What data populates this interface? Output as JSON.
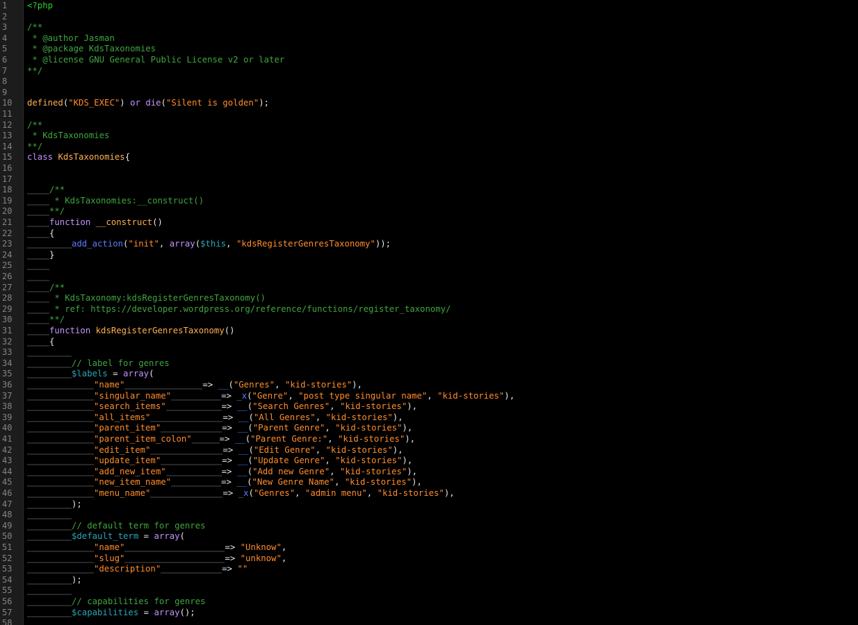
{
  "editor": {
    "lines": [
      {
        "n": "1",
        "indent": 0,
        "tokens": [
          {
            "t": "<?php",
            "c": "tag"
          }
        ]
      },
      {
        "n": "2",
        "indent": 0,
        "tokens": []
      },
      {
        "n": "3",
        "indent": 0,
        "tokens": [
          {
            "t": "/**",
            "c": "comment"
          }
        ]
      },
      {
        "n": "4",
        "indent": 0,
        "tokens": [
          {
            "t": " * @author Jasman",
            "c": "comment"
          }
        ]
      },
      {
        "n": "5",
        "indent": 0,
        "tokens": [
          {
            "t": " * @package KdsTaxonomies",
            "c": "comment"
          }
        ]
      },
      {
        "n": "6",
        "indent": 0,
        "tokens": [
          {
            "t": " * @license GNU General Public License v2 or later",
            "c": "comment"
          }
        ]
      },
      {
        "n": "7",
        "indent": 0,
        "tokens": [
          {
            "t": "**/",
            "c": "comment"
          }
        ]
      },
      {
        "n": "8",
        "indent": 0,
        "tokens": []
      },
      {
        "n": "9",
        "indent": 0,
        "tokens": []
      },
      {
        "n": "10",
        "indent": 0,
        "tokens": [
          {
            "t": "defined",
            "c": "func"
          },
          {
            "t": "(",
            "c": "plain"
          },
          {
            "t": "\"KDS_EXEC\"",
            "c": "string"
          },
          {
            "t": ") ",
            "c": "plain"
          },
          {
            "t": "or",
            "c": "keyword"
          },
          {
            "t": " ",
            "c": "plain"
          },
          {
            "t": "die",
            "c": "keyword"
          },
          {
            "t": "(",
            "c": "plain"
          },
          {
            "t": "\"Silent is golden\"",
            "c": "string"
          },
          {
            "t": ");",
            "c": "plain"
          }
        ]
      },
      {
        "n": "11",
        "indent": 0,
        "tokens": []
      },
      {
        "n": "12",
        "indent": 0,
        "tokens": [
          {
            "t": "/**",
            "c": "comment"
          }
        ]
      },
      {
        "n": "13",
        "indent": 0,
        "tokens": [
          {
            "t": " * KdsTaxonomies",
            "c": "comment"
          }
        ]
      },
      {
        "n": "14",
        "indent": 0,
        "tokens": [
          {
            "t": "**/",
            "c": "comment"
          }
        ]
      },
      {
        "n": "15",
        "indent": 0,
        "tokens": [
          {
            "t": "class",
            "c": "keyword"
          },
          {
            "t": " ",
            "c": "plain"
          },
          {
            "t": "KdsTaxonomies",
            "c": "func"
          },
          {
            "t": "{",
            "c": "plain"
          }
        ]
      },
      {
        "n": "16",
        "indent": 0,
        "tokens": []
      },
      {
        "n": "17",
        "indent": 0,
        "tokens": []
      },
      {
        "n": "18",
        "indent": 1,
        "tokens": [
          {
            "t": "/**",
            "c": "comment"
          }
        ]
      },
      {
        "n": "19",
        "indent": 1,
        "tokens": [
          {
            "t": " * KdsTaxonomies:__construct()",
            "c": "comment"
          }
        ]
      },
      {
        "n": "20",
        "indent": 1,
        "tokens": [
          {
            "t": "**/",
            "c": "comment"
          }
        ]
      },
      {
        "n": "21",
        "indent": 1,
        "tokens": [
          {
            "t": "function",
            "c": "keyword"
          },
          {
            "t": " ",
            "c": "plain"
          },
          {
            "t": "__construct",
            "c": "func"
          },
          {
            "t": "()",
            "c": "plain"
          }
        ]
      },
      {
        "n": "22",
        "indent": 1,
        "tokens": [
          {
            "t": "{",
            "c": "plain"
          }
        ]
      },
      {
        "n": "23",
        "indent": 2,
        "tokens": [
          {
            "t": "add_action",
            "c": "builtin"
          },
          {
            "t": "(",
            "c": "plain"
          },
          {
            "t": "\"init\"",
            "c": "string"
          },
          {
            "t": ", ",
            "c": "plain"
          },
          {
            "t": "array",
            "c": "keyword"
          },
          {
            "t": "(",
            "c": "plain"
          },
          {
            "t": "$this",
            "c": "var"
          },
          {
            "t": ", ",
            "c": "plain"
          },
          {
            "t": "\"kdsRegisterGenresTaxonomy\"",
            "c": "string"
          },
          {
            "t": "));",
            "c": "plain"
          }
        ]
      },
      {
        "n": "24",
        "indent": 1,
        "tokens": [
          {
            "t": "}",
            "c": "plain"
          }
        ]
      },
      {
        "n": "25",
        "indent": 1,
        "tokens": []
      },
      {
        "n": "26",
        "indent": 1,
        "tokens": []
      },
      {
        "n": "27",
        "indent": 1,
        "tokens": [
          {
            "t": "/**",
            "c": "comment"
          }
        ]
      },
      {
        "n": "28",
        "indent": 1,
        "tokens": [
          {
            "t": " * KdsTaxonomy:kdsRegisterGenresTaxonomy()",
            "c": "comment"
          }
        ]
      },
      {
        "n": "29",
        "indent": 1,
        "tokens": [
          {
            "t": " * ref: https://developer.wordpress.org/reference/functions/register_taxonomy/",
            "c": "comment"
          }
        ]
      },
      {
        "n": "30",
        "indent": 1,
        "tokens": [
          {
            "t": "**/",
            "c": "comment"
          }
        ]
      },
      {
        "n": "31",
        "indent": 1,
        "tokens": [
          {
            "t": "function",
            "c": "keyword"
          },
          {
            "t": " ",
            "c": "plain"
          },
          {
            "t": "kdsRegisterGenresTaxonomy",
            "c": "func"
          },
          {
            "t": "()",
            "c": "plain"
          }
        ]
      },
      {
        "n": "32",
        "indent": 1,
        "tokens": [
          {
            "t": "{",
            "c": "plain"
          }
        ]
      },
      {
        "n": "33",
        "indent": 2,
        "tokens": []
      },
      {
        "n": "34",
        "indent": 2,
        "tokens": [
          {
            "t": "// label for genres",
            "c": "comment"
          }
        ]
      },
      {
        "n": "35",
        "indent": 2,
        "tokens": [
          {
            "t": "$labels",
            "c": "var"
          },
          {
            "t": " = ",
            "c": "plain"
          },
          {
            "t": "array",
            "c": "keyword"
          },
          {
            "t": "(",
            "c": "plain"
          }
        ]
      },
      {
        "n": "36",
        "indent": 3,
        "tokens": [
          {
            "t": "\"name\"",
            "c": "string"
          },
          {
            "pad": 14
          },
          {
            "t": "=> ",
            "c": "plain"
          },
          {
            "t": "__",
            "c": "builtin"
          },
          {
            "t": "(",
            "c": "plain"
          },
          {
            "t": "\"Genres\"",
            "c": "string"
          },
          {
            "t": ", ",
            "c": "plain"
          },
          {
            "t": "\"kid-stories\"",
            "c": "string"
          },
          {
            "t": "),",
            "c": "plain"
          }
        ]
      },
      {
        "n": "37",
        "indent": 3,
        "tokens": [
          {
            "t": "\"singular_name\"",
            "c": "string"
          },
          {
            "pad": 9
          },
          {
            "t": "=> ",
            "c": "plain"
          },
          {
            "t": "_x",
            "c": "builtin"
          },
          {
            "t": "(",
            "c": "plain"
          },
          {
            "t": "\"Genre\"",
            "c": "string"
          },
          {
            "t": ", ",
            "c": "plain"
          },
          {
            "t": "\"post type singular name\"",
            "c": "string"
          },
          {
            "t": ", ",
            "c": "plain"
          },
          {
            "t": "\"kid-stories\"",
            "c": "string"
          },
          {
            "t": "),",
            "c": "plain"
          }
        ]
      },
      {
        "n": "38",
        "indent": 3,
        "tokens": [
          {
            "t": "\"search_items\"",
            "c": "string"
          },
          {
            "pad": 10
          },
          {
            "t": "=> ",
            "c": "plain"
          },
          {
            "t": "__",
            "c": "builtin"
          },
          {
            "t": "(",
            "c": "plain"
          },
          {
            "t": "\"Search Genres\"",
            "c": "string"
          },
          {
            "t": ", ",
            "c": "plain"
          },
          {
            "t": "\"kid-stories\"",
            "c": "string"
          },
          {
            "t": "),",
            "c": "plain"
          }
        ]
      },
      {
        "n": "39",
        "indent": 3,
        "tokens": [
          {
            "t": "\"all_items\"",
            "c": "string"
          },
          {
            "pad": 13
          },
          {
            "t": "=> ",
            "c": "plain"
          },
          {
            "t": "__",
            "c": "builtin"
          },
          {
            "t": "(",
            "c": "plain"
          },
          {
            "t": "\"All Genres\"",
            "c": "string"
          },
          {
            "t": ", ",
            "c": "plain"
          },
          {
            "t": "\"kid-stories\"",
            "c": "string"
          },
          {
            "t": "),",
            "c": "plain"
          }
        ]
      },
      {
        "n": "40",
        "indent": 3,
        "tokens": [
          {
            "t": "\"parent_item\"",
            "c": "string"
          },
          {
            "pad": 11
          },
          {
            "t": "=> ",
            "c": "plain"
          },
          {
            "t": "__",
            "c": "builtin"
          },
          {
            "t": "(",
            "c": "plain"
          },
          {
            "t": "\"Parent Genre\"",
            "c": "string"
          },
          {
            "t": ", ",
            "c": "plain"
          },
          {
            "t": "\"kid-stories\"",
            "c": "string"
          },
          {
            "t": "),",
            "c": "plain"
          }
        ]
      },
      {
        "n": "41",
        "indent": 3,
        "tokens": [
          {
            "t": "\"parent_item_colon\"",
            "c": "string"
          },
          {
            "pad": 5
          },
          {
            "t": "=> ",
            "c": "plain"
          },
          {
            "t": "__",
            "c": "builtin"
          },
          {
            "t": "(",
            "c": "plain"
          },
          {
            "t": "\"Parent Genre:\"",
            "c": "string"
          },
          {
            "t": ", ",
            "c": "plain"
          },
          {
            "t": "\"kid-stories\"",
            "c": "string"
          },
          {
            "t": "),",
            "c": "plain"
          }
        ]
      },
      {
        "n": "42",
        "indent": 3,
        "tokens": [
          {
            "t": "\"edit_item\"",
            "c": "string"
          },
          {
            "pad": 13
          },
          {
            "t": "=> ",
            "c": "plain"
          },
          {
            "t": "__",
            "c": "builtin"
          },
          {
            "t": "(",
            "c": "plain"
          },
          {
            "t": "\"Edit Genre\"",
            "c": "string"
          },
          {
            "t": ", ",
            "c": "plain"
          },
          {
            "t": "\"kid-stories\"",
            "c": "string"
          },
          {
            "t": "),",
            "c": "plain"
          }
        ]
      },
      {
        "n": "43",
        "indent": 3,
        "tokens": [
          {
            "t": "\"update_item\"",
            "c": "string"
          },
          {
            "pad": 11
          },
          {
            "t": "=> ",
            "c": "plain"
          },
          {
            "t": "__",
            "c": "builtin"
          },
          {
            "t": "(",
            "c": "plain"
          },
          {
            "t": "\"Update Genre\"",
            "c": "string"
          },
          {
            "t": ", ",
            "c": "plain"
          },
          {
            "t": "\"kid-stories\"",
            "c": "string"
          },
          {
            "t": "),",
            "c": "plain"
          }
        ]
      },
      {
        "n": "44",
        "indent": 3,
        "tokens": [
          {
            "t": "\"add_new_item\"",
            "c": "string"
          },
          {
            "pad": 10
          },
          {
            "t": "=> ",
            "c": "plain"
          },
          {
            "t": "__",
            "c": "builtin"
          },
          {
            "t": "(",
            "c": "plain"
          },
          {
            "t": "\"Add new Genre\"",
            "c": "string"
          },
          {
            "t": ", ",
            "c": "plain"
          },
          {
            "t": "\"kid-stories\"",
            "c": "string"
          },
          {
            "t": "),",
            "c": "plain"
          }
        ]
      },
      {
        "n": "45",
        "indent": 3,
        "tokens": [
          {
            "t": "\"new_item_name\"",
            "c": "string"
          },
          {
            "pad": 9
          },
          {
            "t": "=> ",
            "c": "plain"
          },
          {
            "t": "__",
            "c": "builtin"
          },
          {
            "t": "(",
            "c": "plain"
          },
          {
            "t": "\"New Genre Name\"",
            "c": "string"
          },
          {
            "t": ", ",
            "c": "plain"
          },
          {
            "t": "\"kid-stories\"",
            "c": "string"
          },
          {
            "t": "),",
            "c": "plain"
          }
        ]
      },
      {
        "n": "46",
        "indent": 3,
        "tokens": [
          {
            "t": "\"menu_name\"",
            "c": "string"
          },
          {
            "pad": 13
          },
          {
            "t": "=> ",
            "c": "plain"
          },
          {
            "t": "_x",
            "c": "builtin"
          },
          {
            "t": "(",
            "c": "plain"
          },
          {
            "t": "\"Genres\"",
            "c": "string"
          },
          {
            "t": ", ",
            "c": "plain"
          },
          {
            "t": "\"admin menu\"",
            "c": "string"
          },
          {
            "t": ", ",
            "c": "plain"
          },
          {
            "t": "\"kid-stories\"",
            "c": "string"
          },
          {
            "t": "),",
            "c": "plain"
          }
        ]
      },
      {
        "n": "47",
        "indent": 2,
        "tokens": [
          {
            "t": ");",
            "c": "plain"
          }
        ]
      },
      {
        "n": "48",
        "indent": 2,
        "tokens": []
      },
      {
        "n": "49",
        "indent": 2,
        "tokens": [
          {
            "t": "// default term for genres",
            "c": "comment"
          }
        ]
      },
      {
        "n": "50",
        "indent": 2,
        "tokens": [
          {
            "t": "$default_term",
            "c": "var"
          },
          {
            "t": " = ",
            "c": "plain"
          },
          {
            "t": "array",
            "c": "keyword"
          },
          {
            "t": "(",
            "c": "plain"
          }
        ]
      },
      {
        "n": "51",
        "indent": 3,
        "tokens": [
          {
            "t": "\"name\"",
            "c": "string"
          },
          {
            "pad": 18
          },
          {
            "t": "=> ",
            "c": "plain"
          },
          {
            "t": "\"Unknow\"",
            "c": "string"
          },
          {
            "t": ",",
            "c": "plain"
          }
        ]
      },
      {
        "n": "52",
        "indent": 3,
        "tokens": [
          {
            "t": "\"slug\"",
            "c": "string"
          },
          {
            "pad": 18
          },
          {
            "t": "=> ",
            "c": "plain"
          },
          {
            "t": "\"unknow\"",
            "c": "string"
          },
          {
            "t": ",",
            "c": "plain"
          }
        ]
      },
      {
        "n": "53",
        "indent": 3,
        "tokens": [
          {
            "t": "\"description\"",
            "c": "string"
          },
          {
            "pad": 11
          },
          {
            "t": "=> ",
            "c": "plain"
          },
          {
            "t": "\"\"",
            "c": "string"
          }
        ]
      },
      {
        "n": "54",
        "indent": 2,
        "tokens": [
          {
            "t": ");",
            "c": "plain"
          }
        ]
      },
      {
        "n": "55",
        "indent": 2,
        "tokens": []
      },
      {
        "n": "56",
        "indent": 2,
        "tokens": [
          {
            "t": "// capabilities for genres",
            "c": "comment"
          }
        ]
      },
      {
        "n": "57",
        "indent": 2,
        "tokens": [
          {
            "t": "$capabilities",
            "c": "var"
          },
          {
            "t": " = ",
            "c": "plain"
          },
          {
            "t": "array",
            "c": "keyword"
          },
          {
            "t": "();",
            "c": "plain"
          }
        ]
      },
      {
        "n": "58",
        "indent": 2,
        "tokens": []
      }
    ]
  }
}
